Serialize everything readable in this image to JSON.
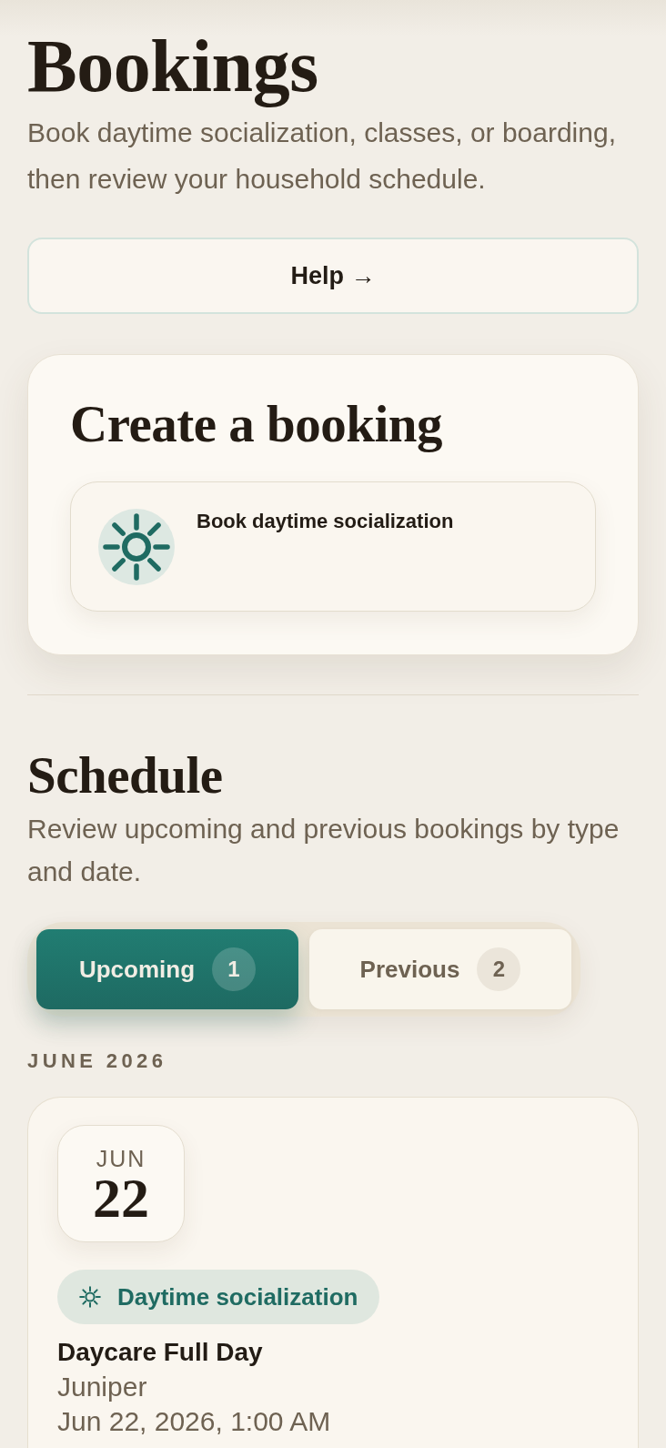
{
  "header": {
    "title": "Bookings",
    "subtitle": "Book daytime socialization, classes, or boarding, then review your household schedule."
  },
  "help_button": {
    "label": "Help →"
  },
  "create_booking": {
    "title": "Create a booking",
    "options": [
      {
        "kind": "daytime",
        "label": "Book daytime socialization"
      }
    ]
  },
  "schedule": {
    "title": "Schedule",
    "description": "Review upcoming and previous bookings by type and date.",
    "tabs": [
      {
        "label": "Upcoming",
        "count": "1",
        "selected": true
      },
      {
        "label": "Previous",
        "count": "2",
        "selected": false
      }
    ],
    "groups": [
      {
        "month": "JUNE 2026",
        "bookings": [
          {
            "date_month": "JUN",
            "date_day": "22",
            "type": {
              "kind": "daytime",
              "label": "Daytime socialization"
            },
            "service": "Daycare Full Day",
            "pet": "Juniper",
            "datetime": "Jun 22, 2026, 1:00 AM"
          }
        ]
      }
    ]
  }
}
